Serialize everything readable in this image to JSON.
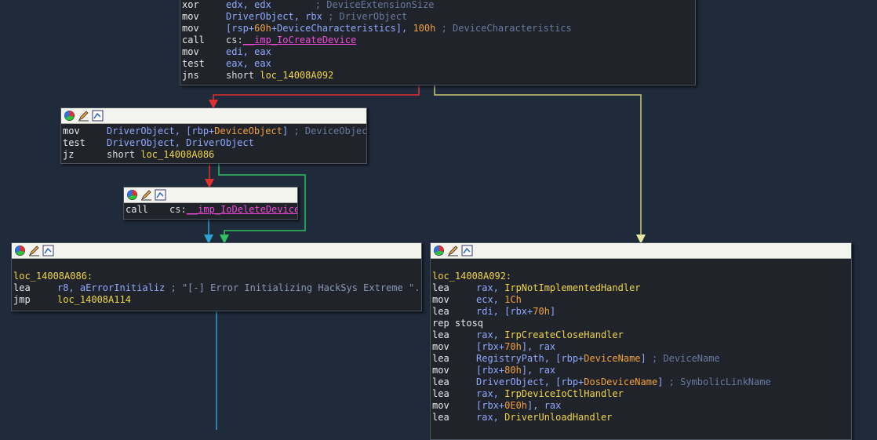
{
  "colors": {
    "background": "#1f2a3a",
    "node_background": "#20242a",
    "edge_false": "#e03030",
    "edge_true": "#30c060",
    "edge_unconditional": "#30a0d0",
    "edge_jump": "#c8c87a",
    "mnemonic": "#e8e8e8",
    "register": "#8fa8ff",
    "immediate": "#f0a040",
    "label": "#f0d54a",
    "import": "#f04bd8",
    "comment": "#6878a0"
  },
  "header_icons": [
    "color-picker-icon",
    "rename-icon",
    "graph-view-icon"
  ],
  "nodes": {
    "top": {
      "lines": [
        {
          "mnemonic": "xor",
          "operands": "edx, edx",
          "comment": "; DeviceExtensionSize"
        },
        {
          "mnemonic": "mov",
          "operands": "DriverObject, rbx",
          "comment": "; DriverObject"
        },
        {
          "mnemonic": "mov",
          "op_a": "[rsp+",
          "op_b": "60h",
          "op_c": "+DeviceCharacteristics], ",
          "op_d": "100h",
          "comment": "; DeviceCharacteristics"
        },
        {
          "mnemonic": "call",
          "op_a": "cs:",
          "op_b": "__imp_IoCreateDevice"
        },
        {
          "mnemonic": "mov",
          "operands": "edi, eax"
        },
        {
          "mnemonic": "test",
          "operands": "eax, eax"
        },
        {
          "mnemonic": "jns",
          "op_a": "short ",
          "op_b": "loc_14008A092"
        }
      ]
    },
    "check": {
      "lines": [
        {
          "mnemonic": "mov",
          "op_a": "DriverObject, [rbp+",
          "op_b": "DeviceObject",
          "op_c": "]",
          "comment": " ; DeviceObject"
        },
        {
          "mnemonic": "test",
          "operands": "DriverObject, DriverObject"
        },
        {
          "mnemonic": "jz",
          "op_a": "short ",
          "op_b": "loc_14008A086"
        }
      ]
    },
    "delete": {
      "lines": [
        {
          "mnemonic": "call",
          "op_a": "cs:",
          "op_b": "__imp_IoDeleteDevice"
        }
      ]
    },
    "error": {
      "label": "loc_14008A086:",
      "lines": [
        {
          "mnemonic": "lea",
          "op_a": "r8, aErrorInitializ",
          "comment": " ; \"[-] Error Initializing HackSys Extreme \"..."
        },
        {
          "mnemonic": "jmp",
          "op_b": "loc_14008A114"
        }
      ]
    },
    "success": {
      "label": "loc_14008A092:",
      "lines": [
        {
          "mnemonic": "lea",
          "op_a": "rax, ",
          "op_b": "IrpNotImplementedHandler"
        },
        {
          "mnemonic": "mov",
          "op_a": "ecx, ",
          "op_c": "1Ch"
        },
        {
          "mnemonic": "lea",
          "op_a": "rdi, [rbx+",
          "op_c": "70h",
          "op_d": "]"
        },
        {
          "mnemonic": "rep stosq",
          "op_a": ""
        },
        {
          "mnemonic": "lea",
          "op_a": "rax, ",
          "op_b": "IrpCreateCloseHandler"
        },
        {
          "mnemonic": "mov",
          "op_a": "[rbx+",
          "op_c": "70h",
          "op_d": "], rax"
        },
        {
          "mnemonic": "lea",
          "op_a": "RegistryPath, [rbp+",
          "op_e": "DeviceName",
          "op_d": "]",
          "comment": " ; DeviceName"
        },
        {
          "mnemonic": "mov",
          "op_a": "[rbx+",
          "op_c": "80h",
          "op_d": "], rax"
        },
        {
          "mnemonic": "lea",
          "op_a": "DriverObject, [rbp+",
          "op_e": "DosDeviceName",
          "op_d": "]",
          "comment": " ; SymbolicLinkName"
        },
        {
          "mnemonic": "lea",
          "op_a": "rax, ",
          "op_b": "IrpDeviceIoCtlHandler"
        },
        {
          "mnemonic": "mov",
          "op_a": "[rbx+",
          "op_c": "0E0h",
          "op_d": "], rax"
        },
        {
          "mnemonic": "lea",
          "op_a": "rax, ",
          "op_b": "DriverUnloadHandler"
        }
      ]
    }
  }
}
